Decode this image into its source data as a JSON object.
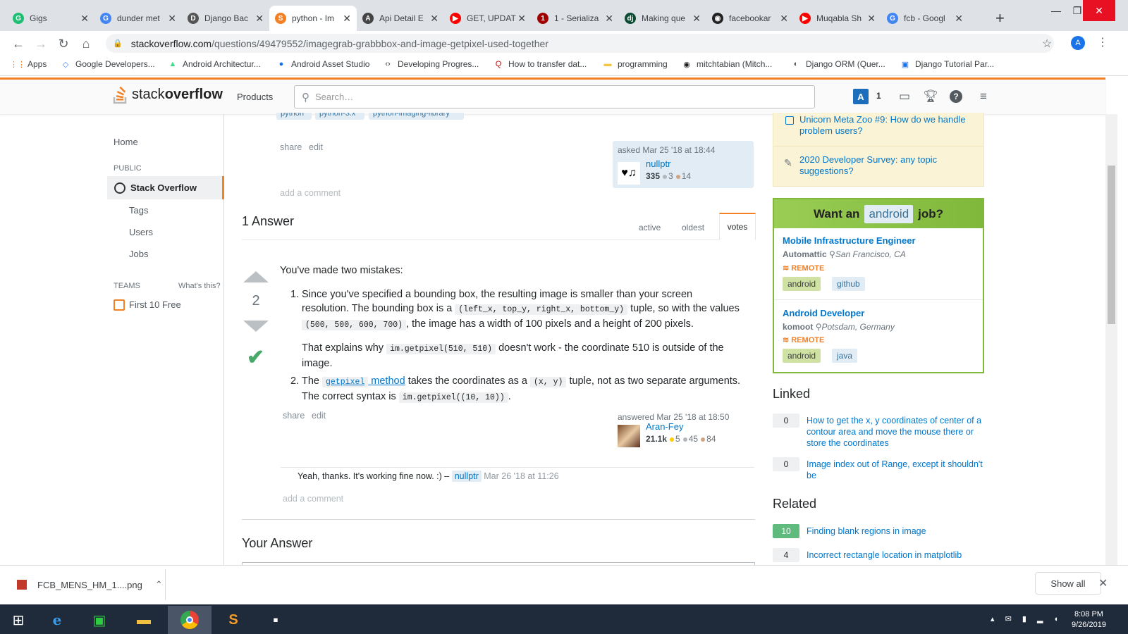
{
  "browser": {
    "tabs": [
      {
        "label": "Gigs",
        "fav": "G",
        "color": "#1dbf73"
      },
      {
        "label": "dunder met",
        "fav": "G",
        "color": "#4285f4"
      },
      {
        "label": "Django Bac",
        "fav": "D",
        "color": "#555555"
      },
      {
        "label": "python - Im",
        "fav": "S",
        "color": "#f48024"
      },
      {
        "label": "Api Detail E",
        "fav": "A",
        "color": "#444444"
      },
      {
        "label": "GET, UPDAT",
        "fav": "▶",
        "color": "#ff0000"
      },
      {
        "label": "1 - Serializa",
        "fav": "1",
        "color": "#a00000"
      },
      {
        "label": "Making que",
        "fav": "dj",
        "color": "#0c4b33"
      },
      {
        "label": "facebookar",
        "fav": "◉",
        "color": "#222222"
      },
      {
        "label": "Muqabla Sh",
        "fav": "▶",
        "color": "#ff0000"
      },
      {
        "label": "fcb - Googl",
        "fav": "G",
        "color": "#4285f4"
      }
    ],
    "url_domain": "stackoverflow.com",
    "url_path": "/questions/49479552/imagegrab-grabbbox-and-image-getpixel-used-together",
    "profile_initial": "A",
    "bookmarks": [
      {
        "label": "Apps"
      },
      {
        "label": "Google Developers..."
      },
      {
        "label": "Android Architectur..."
      },
      {
        "label": "Android Asset Studio"
      },
      {
        "label": "Developing Progres..."
      },
      {
        "label": "How to transfer dat..."
      },
      {
        "label": "programming"
      },
      {
        "label": "mitchtabian (Mitch..."
      },
      {
        "label": "Django ORM (Quer..."
      },
      {
        "label": "Django Tutorial Par..."
      }
    ]
  },
  "so": {
    "logo_light": "stack",
    "logo_bold": "overflow",
    "products": "Products",
    "search_placeholder": "Search…",
    "user_initial": "A",
    "reputation": "1"
  },
  "leftnav": {
    "home": "Home",
    "public": "PUBLIC",
    "stack_overflow": "Stack Overflow",
    "tags": "Tags",
    "users": "Users",
    "jobs": "Jobs",
    "teams": "TEAMS",
    "whats_this": "What's this?",
    "first_free": "First 10 Free"
  },
  "question": {
    "tags": [
      "python",
      "python-3.x",
      "python-imaging-library"
    ],
    "share": "share",
    "edit": "edit",
    "asked": "asked Mar 25 '18 at 18:44",
    "user": "nullptr",
    "rep": "335",
    "silver": "3",
    "bronze": "14",
    "add_comment": "add a comment"
  },
  "answers": {
    "count_label": "1 Answer",
    "sort": {
      "active": "active",
      "oldest": "oldest",
      "votes": "votes"
    },
    "vote_count": "2",
    "intro": "You've made two mistakes:",
    "p1_a": "Since you've specified a bounding box, the resulting image is smaller than your screen resolution. The bounding box is a",
    "p1_code1": "(left_x, top_y, right_x, bottom_y)",
    "p1_b": "tuple, so with the values",
    "p1_code2": "(500, 500, 600, 700)",
    "p1_c": ", the image has a width of 100 pixels and a height of 200 pixels.",
    "p1b_a": "That explains why",
    "p1b_code": "im.getpixel(510, 510)",
    "p1b_b": "doesn't work - the coordinate 510 is outside of the image.",
    "p2_a": "The",
    "p2_link_code": "getpixel",
    "p2_link_text": "method",
    "p2_b": "takes the coordinates as a",
    "p2_code1": "(x, y)",
    "p2_c": "tuple, not as two separate arguments. The correct syntax is",
    "p2_code2": "im.getpixel((10, 10))",
    "p2_d": ".",
    "share": "share",
    "edit": "edit",
    "answered": "answered Mar 25 '18 at 18:50",
    "user": "Aran-Fey",
    "rep": "21.1k",
    "gold": "5",
    "silver": "45",
    "bronze": "84",
    "comment_text": "Yeah, thanks. It's working fine now. :) –",
    "comment_user": "nullptr",
    "comment_date": "Mar 26 '18 at 11:26",
    "add_comment": "add a comment",
    "your_answer": "Your Answer"
  },
  "sidebar": {
    "meta1": "Unicorn Meta Zoo #9: How do we handle problem users?",
    "meta2": "2020 Developer Survey: any topic suggestions?",
    "jobs_want": "Want an",
    "jobs_kw": "android",
    "jobs_job": "job?",
    "job1": {
      "title": "Mobile Infrastructure Engineer",
      "company": "Automattic",
      "location": "San Francisco, CA",
      "remote": "REMOTE",
      "tags": [
        "android",
        "github"
      ]
    },
    "job2": {
      "title": "Android Developer",
      "company": "komoot",
      "location": "Potsdam, Germany",
      "remote": "REMOTE",
      "tags": [
        "android",
        "java"
      ]
    },
    "linked_h": "Linked",
    "linked": [
      {
        "score": "0",
        "text": "How to get the x, y coordinates of center of a contour area and move the mouse there or store the coordinates"
      },
      {
        "score": "0",
        "text": "Image index out of Range, except it shouldn't be"
      }
    ],
    "related_h": "Related",
    "related": [
      {
        "score": "10",
        "text": "Finding blank regions in image"
      },
      {
        "score": "4",
        "text": "Incorrect rectangle location in matplotlib"
      }
    ]
  },
  "downloads": {
    "file": "FCB_MENS_HM_1....png",
    "show_all": "Show all"
  },
  "taskbar": {
    "time": "8:08 PM",
    "date": "9/26/2019"
  }
}
